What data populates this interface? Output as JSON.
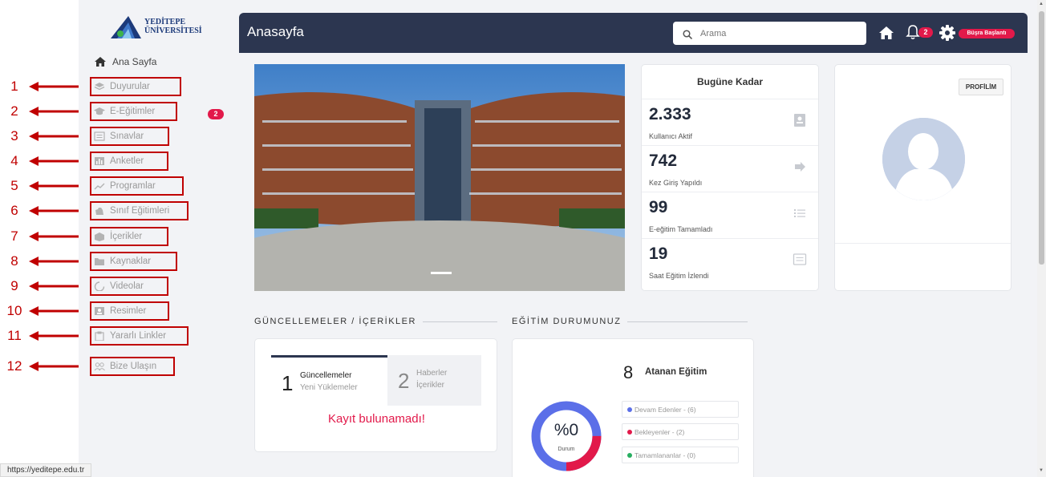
{
  "logo": {
    "line1": "YEDİTEPE",
    "line2": "ÜNİVERSİTESİ"
  },
  "sidebar": {
    "home_label": "Ana Sayfa",
    "items": [
      {
        "num": "1",
        "label": "Duyurular",
        "icon": "layers-icon"
      },
      {
        "num": "2",
        "label": "E-Eğitimler",
        "icon": "graduation-cap-icon",
        "badge": "2"
      },
      {
        "num": "3",
        "label": "Sınavlar",
        "icon": "list-box-icon"
      },
      {
        "num": "4",
        "label": "Anketler",
        "icon": "bar-chart-icon"
      },
      {
        "num": "5",
        "label": "Programlar",
        "icon": "trend-line-icon"
      },
      {
        "num": "6",
        "label": "Sınıf Eğitimleri",
        "icon": "hand-icon"
      },
      {
        "num": "7",
        "label": "İçerikler",
        "icon": "cube-icon"
      },
      {
        "num": "8",
        "label": "Kaynaklar",
        "icon": "folder-icon"
      },
      {
        "num": "9",
        "label": "Videolar",
        "icon": "circle-notch-icon"
      },
      {
        "num": "10",
        "label": "Resimler",
        "icon": "image-icon"
      },
      {
        "num": "11",
        "label": "Yararlı Linkler",
        "icon": "clipboard-icon"
      },
      {
        "num": "12",
        "label": "Bize Ulaşın",
        "icon": "users-icon"
      }
    ]
  },
  "status_url": "https://yeditepe.edu.tr",
  "topbar": {
    "title": "Anasayfa",
    "search_placeholder": "Arama",
    "notification_count": "2",
    "user_label": "Büşra Başlantı"
  },
  "stats": {
    "header": "Bugüne Kadar",
    "rows": [
      {
        "value": "2.333",
        "label": "Kullanıcı Aktif",
        "icon": "id-card-icon"
      },
      {
        "value": "742",
        "label": "Kez Giriş Yapıldı",
        "icon": "arrow-right-icon"
      },
      {
        "value": "99",
        "label": "E-eğitim Tamamladı",
        "icon": "list-icon"
      },
      {
        "value": "19",
        "label": "Saat Eğitim İzlendi",
        "icon": "message-icon"
      }
    ]
  },
  "profile": {
    "button_label": "PROFİLİM"
  },
  "sections": {
    "updates_title": "GÜNCELLEMELER / İÇERİKLER",
    "edu_title": "EĞİTİM DURUMUNUZ"
  },
  "updates": {
    "tabs": [
      {
        "num": "1",
        "title": "Güncellemeler",
        "subtitle": "Yeni Yüklemeler"
      },
      {
        "num": "2",
        "title": "Haberler",
        "subtitle": "İçerikler"
      }
    ],
    "empty_message": "Kayıt bulunamadı!"
  },
  "education": {
    "count": "8",
    "count_label": "Atanan Eğitim",
    "status_value": "%0",
    "status_label": "Durum",
    "progress_fraction": 0,
    "legend": [
      {
        "label": "Devam Edenler - (6)",
        "color": "#5b6fe8"
      },
      {
        "label": "Bekleyenler - (2)",
        "color": "#e2194a"
      },
      {
        "label": "Tamamlananlar - (0)",
        "color": "#27ae60"
      }
    ]
  },
  "colors": {
    "topbar": "#2c3650",
    "accent": "#e2194a",
    "annotation": "#c00000"
  }
}
